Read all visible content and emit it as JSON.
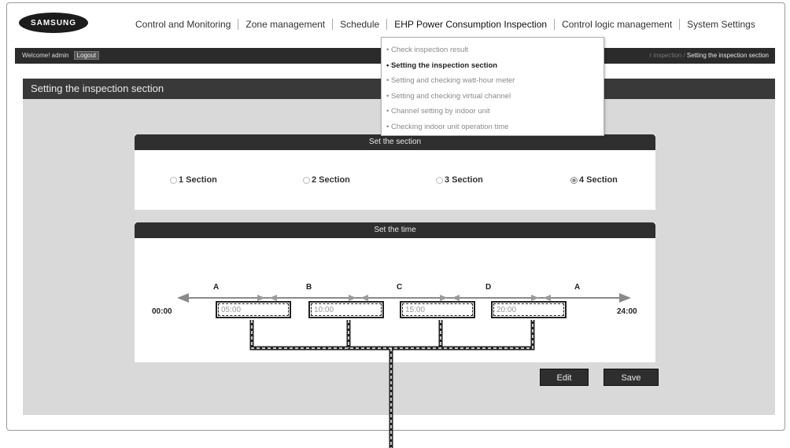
{
  "brand": {
    "logo": "SAMSUNG"
  },
  "nav": {
    "items": [
      "Control and Monitoring",
      "Zone management",
      "Schedule",
      "EHP Power Consumption Inspection",
      "Control logic management",
      "System Settings"
    ]
  },
  "userbar": {
    "welcome": "Welcome! admin",
    "logout": "Logout",
    "breadcrumb_faded": "r inspection  /",
    "breadcrumb_current": "Setting the inspection section"
  },
  "dropdown": {
    "items": [
      "• Check inspection result",
      "• Setting the inspection section",
      "• Setting and checking watt-hour meter",
      "• Setting and checking virtual channel",
      "• Channel setting by indoor unit",
      "• Checking indoor unit operation time"
    ]
  },
  "page": {
    "title": "Setting the inspection section"
  },
  "section_panel": {
    "header": "Set the section",
    "options": [
      "1 Section",
      "2 Section",
      "3 Section",
      "4 Section"
    ],
    "selected": "4 Section"
  },
  "time_panel": {
    "header": "Set the time",
    "start": "00:00",
    "end": "24:00",
    "zone_labels": [
      "A",
      "B",
      "C",
      "D",
      "A"
    ],
    "inputs": [
      "05:00",
      "10:00",
      "15:00",
      "20:00"
    ]
  },
  "buttons": {
    "edit": "Edit",
    "save": "Save"
  }
}
